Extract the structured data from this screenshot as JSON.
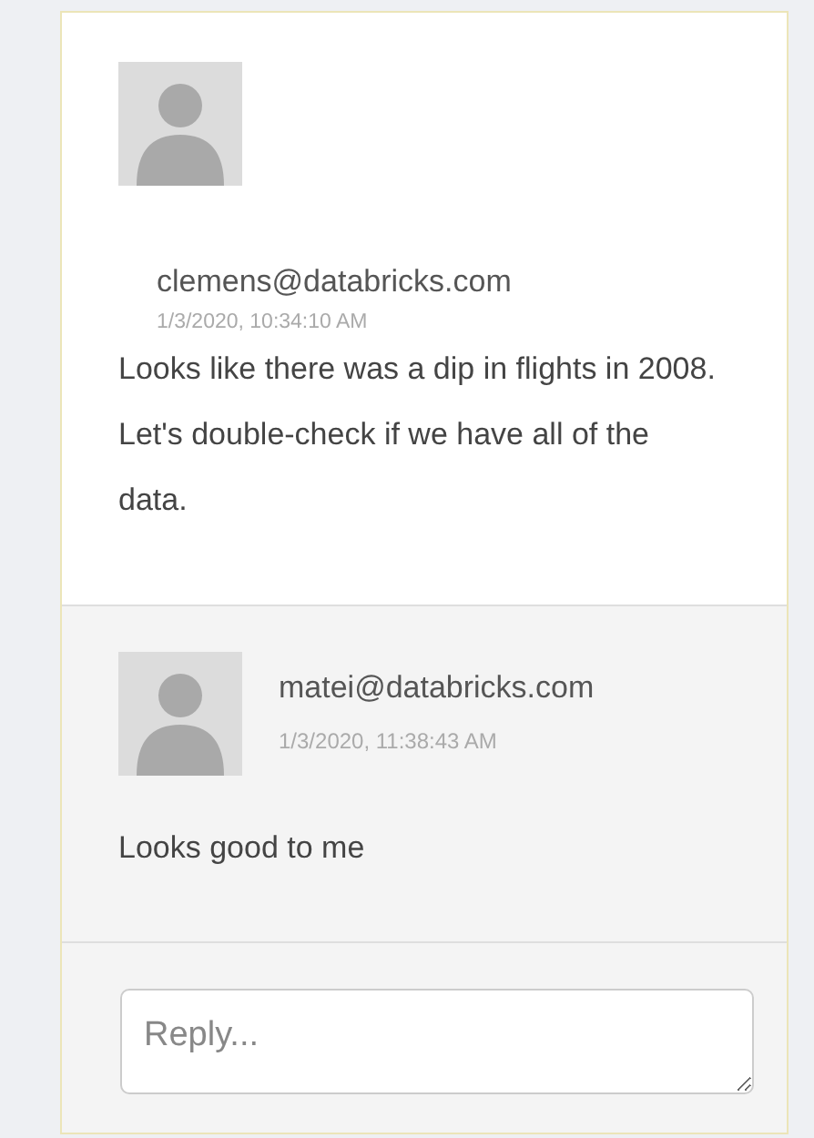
{
  "comment": {
    "author": "clemens@databricks.com",
    "time": "1/3/2020, 10:34:10 AM",
    "text": "Looks like there was a dip in flights in 2008. Let's double-check if we have all of the data."
  },
  "replies": [
    {
      "author": "matei@databricks.com",
      "time": "1/3/2020, 11:38:43 AM",
      "text": "Looks good to me"
    }
  ],
  "reply_field": {
    "placeholder": "Reply..."
  }
}
